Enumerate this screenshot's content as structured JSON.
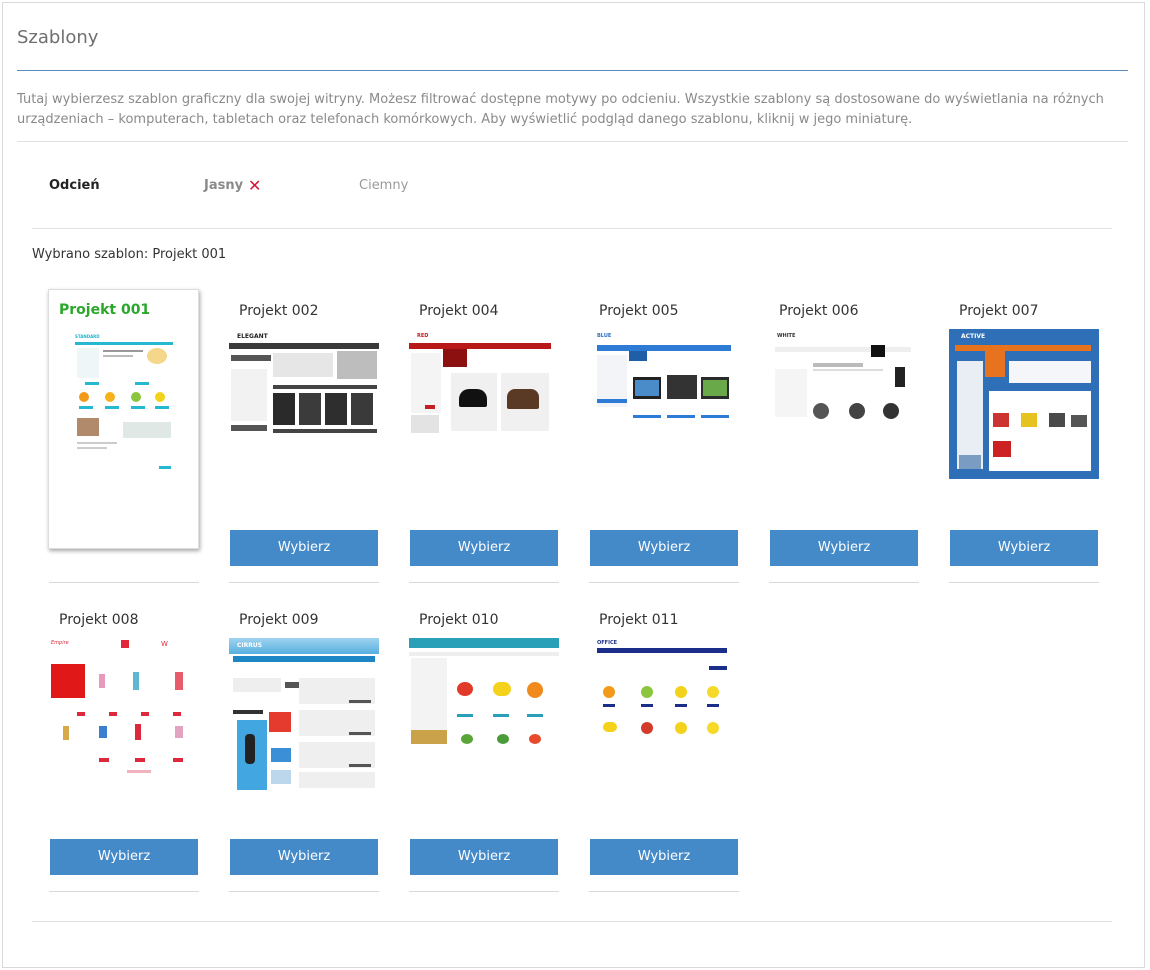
{
  "page": {
    "title": "Szablony",
    "description": "Tutaj wybierzesz szablon graficzny dla swojej witryny. Możesz filtrować dostępne motywy po odcieniu. Wszystkie szablony są dostosowane do wyświetlania na różnych urządzeniach – komputerach, tabletach oraz telefonach komórkowych. Aby wyświetlić podgląd danego szablonu, kliknij w jego miniaturę."
  },
  "filter": {
    "label": "Odcień",
    "options": [
      "Jasny",
      "Ciemny"
    ],
    "active": "Jasny",
    "remove_glyph": "✕"
  },
  "selection": {
    "text": "Wybrano szablon: Projekt 001"
  },
  "colors": {
    "accent": "#4489c8",
    "selected_name": "#2aa62a",
    "remove": "#d2143a"
  },
  "templates": [
    {
      "name": "Projekt 001",
      "selected": true,
      "thumb_label": "STANDARD"
    },
    {
      "name": "Projekt 002",
      "button": "Wybierz",
      "thumb_label": "ELEGANT"
    },
    {
      "name": "Projekt 004",
      "button": "Wybierz",
      "thumb_label": "RED"
    },
    {
      "name": "Projekt 005",
      "button": "Wybierz",
      "thumb_label": "BLUE"
    },
    {
      "name": "Projekt 006",
      "button": "Wybierz",
      "thumb_label": "WHITE"
    },
    {
      "name": "Projekt 007",
      "button": "Wybierz",
      "thumb_label": "ACTIVE"
    },
    {
      "name": "Projekt 008",
      "button": "Wybierz",
      "thumb_label": "Empire"
    },
    {
      "name": "Projekt 009",
      "button": "Wybierz",
      "thumb_label": "CIRRUS"
    },
    {
      "name": "Projekt 010",
      "button": "Wybierz",
      "thumb_label": ""
    },
    {
      "name": "Projekt 011",
      "button": "Wybierz",
      "thumb_label": "OFFICE"
    }
  ]
}
